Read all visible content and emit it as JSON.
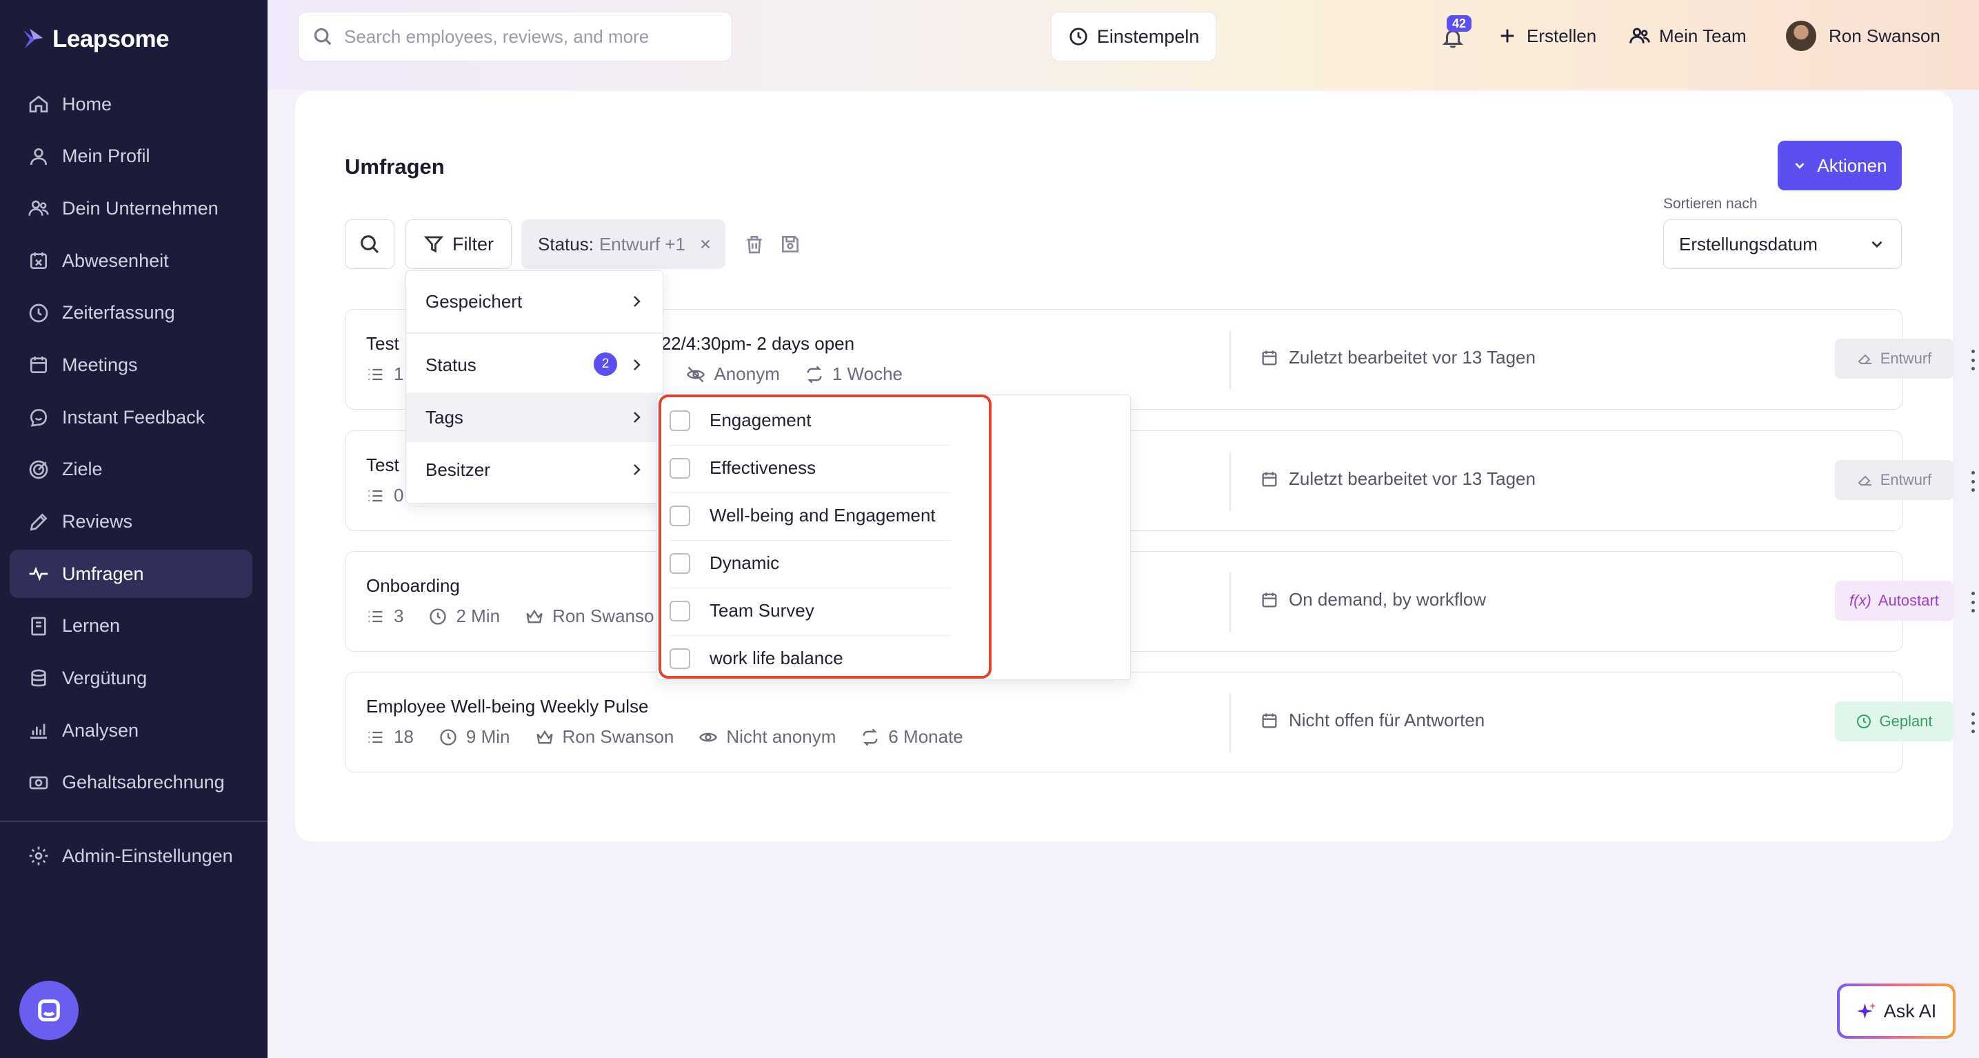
{
  "app": {
    "name": "Leapsome"
  },
  "sidebar": {
    "items": [
      {
        "label": "Home",
        "icon": "home-icon"
      },
      {
        "label": "Mein Profil",
        "icon": "user-icon"
      },
      {
        "label": "Dein Unternehmen",
        "icon": "users-icon"
      },
      {
        "label": "Abwesenheit",
        "icon": "calendar-x-icon"
      },
      {
        "label": "Zeiterfassung",
        "icon": "clock-icon"
      },
      {
        "label": "Meetings",
        "icon": "calendar-icon"
      },
      {
        "label": "Instant Feedback",
        "icon": "chat-smile-icon"
      },
      {
        "label": "Ziele",
        "icon": "target-icon"
      },
      {
        "label": "Reviews",
        "icon": "pen-icon"
      },
      {
        "label": "Umfragen",
        "icon": "pulse-icon",
        "active": true
      },
      {
        "label": "Lernen",
        "icon": "book-icon"
      },
      {
        "label": "Vergütung",
        "icon": "coins-icon"
      },
      {
        "label": "Analysen",
        "icon": "chart-icon"
      },
      {
        "label": "Gehaltsabrechnung",
        "icon": "money-icon"
      }
    ],
    "admin_label": "Admin-Einstellungen"
  },
  "header": {
    "search_placeholder": "Search employees, reviews, and more",
    "clock_in_label": "Einstempeln",
    "notification_count": "42",
    "create_label": "Erstellen",
    "team_label": "Mein Team",
    "user_name": "Ron Swanson"
  },
  "main": {
    "title": "Umfragen",
    "actions_label": "Aktionen",
    "sort_label": "Sortieren nach",
    "sort_value": "Erstellungsdatum",
    "filter_label": "Filter",
    "status_chip_key": "Status:",
    "status_chip_value": "Entwurf +1"
  },
  "surveys": [
    {
      "title": "Test",
      "title_tail": "22/4:30pm- 2 days open",
      "questions": "1",
      "anon": "Anonym",
      "frequency": "1 Woche",
      "date": "Zuletzt bearbeitet vor 13 Tagen",
      "badge": "Entwurf"
    },
    {
      "title": "Test",
      "questions": "0",
      "date": "Zuletzt bearbeitet vor 13 Tagen",
      "badge": "Entwurf"
    },
    {
      "title": "Onboarding",
      "questions": "3",
      "duration": "2 Min",
      "owner": "Ron Swanso",
      "date": "On demand, by workflow",
      "badge": "Autostart"
    },
    {
      "title": "Employee Well-being Weekly Pulse",
      "questions": "18",
      "duration": "9 Min",
      "owner": "Ron Swanson",
      "anon": "Nicht anonym",
      "frequency": "6 Monate",
      "date": "Nicht offen für Antworten",
      "badge": "Geplant"
    }
  ],
  "filter_menu": {
    "items": [
      {
        "label": "Gespeichert"
      },
      {
        "label": "Status",
        "count": "2"
      },
      {
        "label": "Tags"
      },
      {
        "label": "Besitzer"
      }
    ]
  },
  "tags_menu": {
    "items": [
      "Engagement",
      "Effectiveness",
      "Well-being and Engagement",
      "Dynamic",
      "Team Survey",
      "work life balance"
    ]
  },
  "ask_ai_label": "Ask AI",
  "colors": {
    "accent": "#5b4ff0",
    "sidebar_bg": "#1c1b3a",
    "highlight": "#e0432e"
  }
}
